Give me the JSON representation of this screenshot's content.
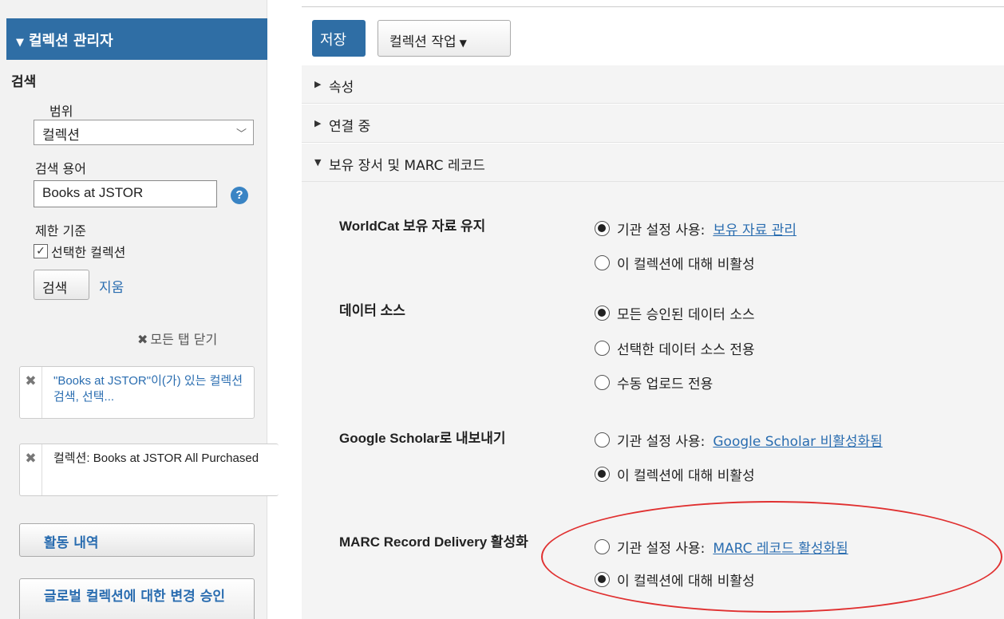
{
  "sidebar": {
    "header": "컬렉션 관리자",
    "search_title": "검색",
    "scope_label": "범위",
    "scope_value": "컬렉션",
    "term_label": "검색 용어",
    "term_value": "Books at JSTOR",
    "limit_label": "제한 기준",
    "limit_checkbox": "선택한 컬렉션",
    "search_button": "검색",
    "clear_link": "지움",
    "close_all": "모든 탭 닫기",
    "crumbs": [
      "\"Books at JSTOR\"이(가) 있는 컬렉션 검색, 선택...",
      "컬렉션: Books at JSTOR All Purchased"
    ],
    "activity_button": "활동 내역",
    "global_button": "글로벌 컬렉션에 대한 변경 승인"
  },
  "toolbar": {
    "save": "저장",
    "actions": "컬렉션 작업"
  },
  "sections": {
    "properties": "속성",
    "linking": "연결 중",
    "holdings": "보유 장서 및 MARC 레코드"
  },
  "fields": {
    "worldcat": {
      "label": "WorldCat 보유 자료 유지",
      "opt1": "기관 설정 사용:",
      "opt1_link": "보유 자료 관리",
      "opt2": "이 컬렉션에 대해 비활성"
    },
    "datasource": {
      "label": "데이터 소스",
      "opt1": "모든 승인된 데이터 소스",
      "opt2": "선택한 데이터 소스 전용",
      "opt3": "수동 업로드 전용"
    },
    "scholar": {
      "label": "Google Scholar로 내보내기",
      "opt1": "기관 설정 사용:",
      "opt1_link": "Google Scholar 비활성화됨",
      "opt2": "이 컬렉션에 대해 비활성"
    },
    "marc": {
      "label": "MARC Record Delivery 활성화",
      "opt1": "기관 설정 사용:",
      "opt1_link": "MARC 레코드 활성화됨",
      "opt2": "이 컬렉션에 대해 비활성"
    }
  },
  "colors": {
    "brand": "#2f6ea5",
    "link": "#2a6db0",
    "highlight": "#e03030"
  }
}
